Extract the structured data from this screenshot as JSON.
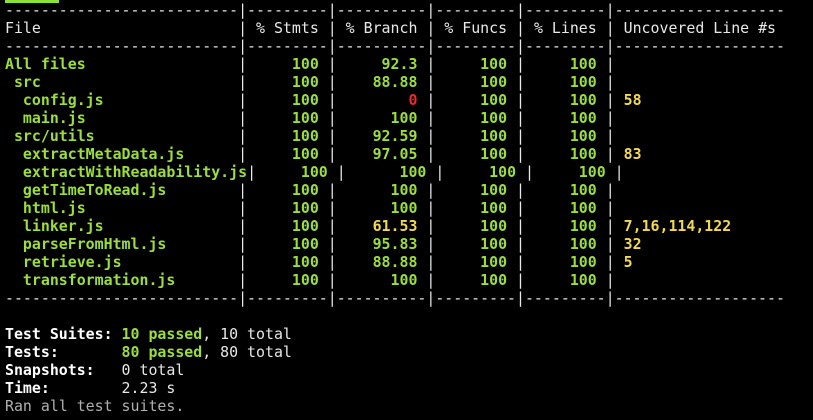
{
  "colors": {
    "background": "#000000",
    "default_text": "#e8e8e8",
    "good": "#9bdf3a",
    "medium": "#f2d94e",
    "low": "#ef2929",
    "uncovered": "#f2d94e"
  },
  "separator": "--------------------------|---------|----------|---------|---------|-------------------",
  "table": {
    "headers": [
      "File",
      "% Stmts",
      "% Branch",
      "% Funcs",
      "% Lines",
      "Uncovered Line #s"
    ],
    "rows": [
      {
        "file": "All files",
        "indent": 0,
        "stmts": "100",
        "branch": "92.3",
        "funcs": "100",
        "lines": "100",
        "uncovered": "",
        "branch_level": "good"
      },
      {
        "file": "src",
        "indent": 1,
        "stmts": "100",
        "branch": "88.88",
        "funcs": "100",
        "lines": "100",
        "uncovered": "",
        "branch_level": "good"
      },
      {
        "file": "config.js",
        "indent": 2,
        "stmts": "100",
        "branch": "0",
        "funcs": "100",
        "lines": "100",
        "uncovered": "58",
        "branch_level": "low"
      },
      {
        "file": "main.js",
        "indent": 2,
        "stmts": "100",
        "branch": "100",
        "funcs": "100",
        "lines": "100",
        "uncovered": "",
        "branch_level": "good"
      },
      {
        "file": "src/utils",
        "indent": 1,
        "stmts": "100",
        "branch": "92.59",
        "funcs": "100",
        "lines": "100",
        "uncovered": "",
        "branch_level": "good"
      },
      {
        "file": "extractMetaData.js",
        "indent": 2,
        "stmts": "100",
        "branch": "97.05",
        "funcs": "100",
        "lines": "100",
        "uncovered": "83",
        "branch_level": "good"
      },
      {
        "file": "extractWithReadability.js",
        "indent": 2,
        "stmts": "100",
        "branch": "100",
        "funcs": "100",
        "lines": "100",
        "uncovered": "",
        "branch_level": "good"
      },
      {
        "file": "getTimeToRead.js",
        "indent": 2,
        "stmts": "100",
        "branch": "100",
        "funcs": "100",
        "lines": "100",
        "uncovered": "",
        "branch_level": "good"
      },
      {
        "file": "html.js",
        "indent": 2,
        "stmts": "100",
        "branch": "100",
        "funcs": "100",
        "lines": "100",
        "uncovered": "",
        "branch_level": "good"
      },
      {
        "file": "linker.js",
        "indent": 2,
        "stmts": "100",
        "branch": "61.53",
        "funcs": "100",
        "lines": "100",
        "uncovered": "7,16,114,122",
        "branch_level": "medium"
      },
      {
        "file": "parseFromHtml.js",
        "indent": 2,
        "stmts": "100",
        "branch": "95.83",
        "funcs": "100",
        "lines": "100",
        "uncovered": "32",
        "branch_level": "good"
      },
      {
        "file": "retrieve.js",
        "indent": 2,
        "stmts": "100",
        "branch": "88.88",
        "funcs": "100",
        "lines": "100",
        "uncovered": "5",
        "branch_level": "good"
      },
      {
        "file": "transformation.js",
        "indent": 2,
        "stmts": "100",
        "branch": "100",
        "funcs": "100",
        "lines": "100",
        "uncovered": "",
        "branch_level": "good"
      }
    ]
  },
  "summary": {
    "test_suites": {
      "label": "Test Suites:",
      "passed": "10 passed",
      "rest": ", 10 total"
    },
    "tests": {
      "label": "Tests:",
      "passed": "80 passed",
      "rest": ", 80 total"
    },
    "snapshots": {
      "label": "Snapshots:",
      "value": "0 total"
    },
    "time": {
      "label": "Time:",
      "value": "2.23 s"
    },
    "footer": "Ran all test suites."
  }
}
